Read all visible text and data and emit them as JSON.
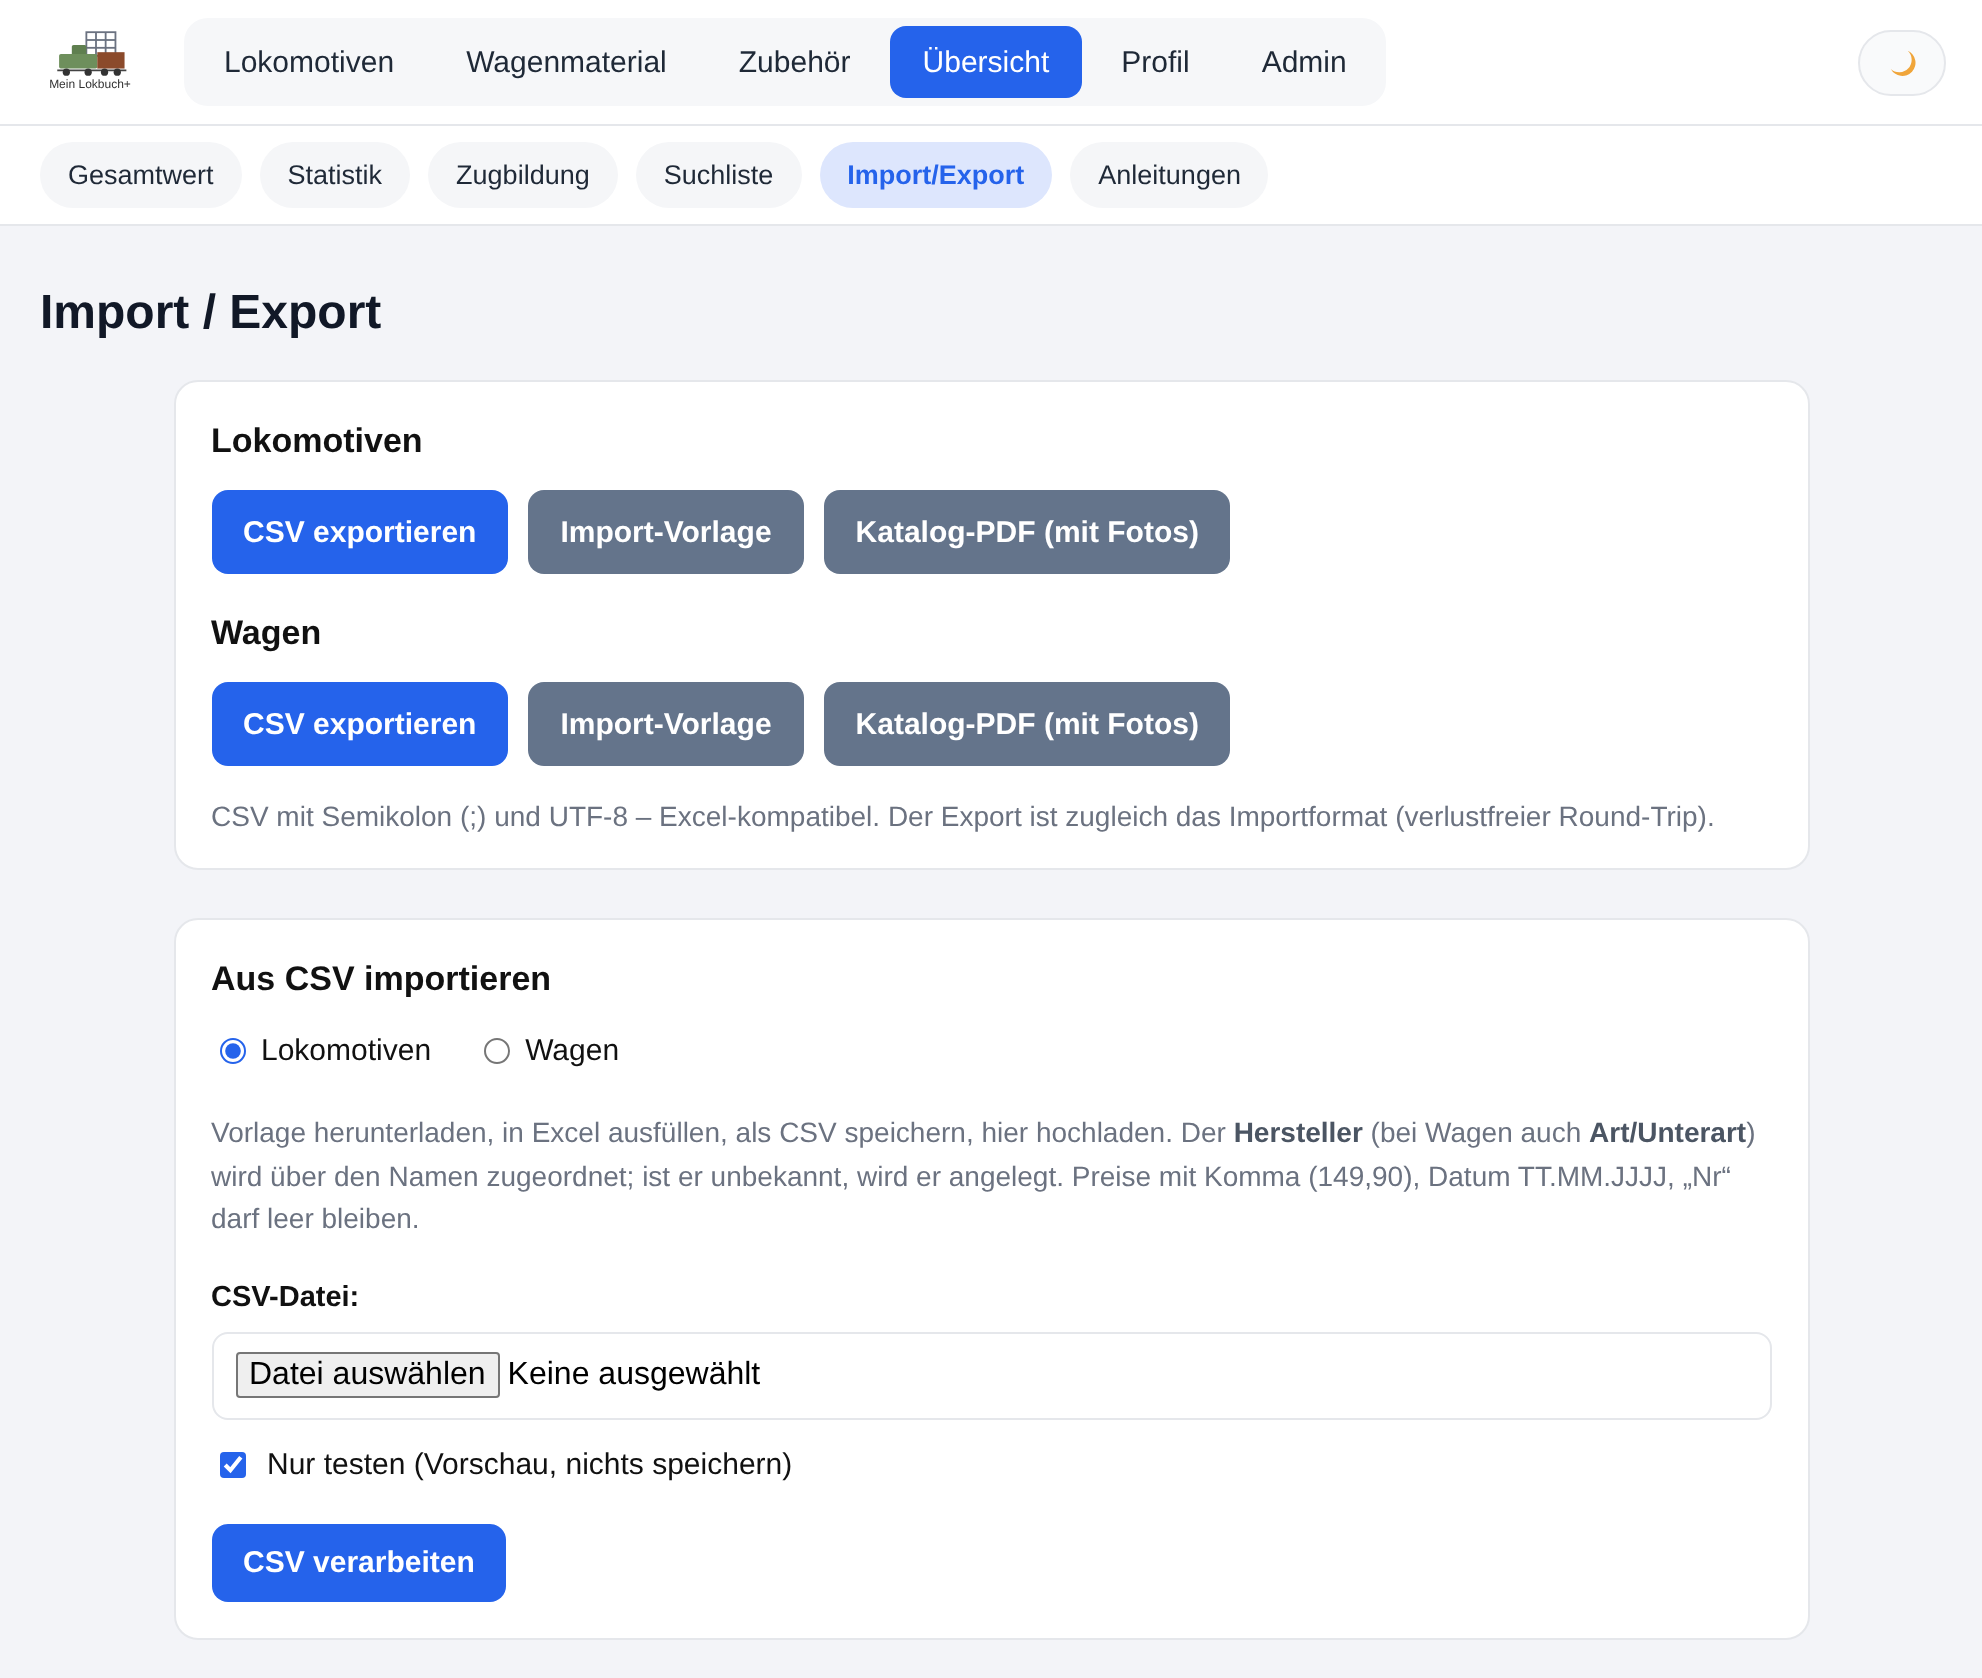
{
  "header": {
    "logo_text": "Mein Lokbuch+",
    "nav": [
      {
        "label": "Lokomotiven",
        "selected": false
      },
      {
        "label": "Wagenmaterial",
        "selected": false
      },
      {
        "label": "Zubehör",
        "selected": false
      },
      {
        "label": "Übersicht",
        "selected": true
      },
      {
        "label": "Profil",
        "selected": false
      },
      {
        "label": "Admin",
        "selected": false
      }
    ]
  },
  "subnav": [
    {
      "label": "Gesamtwert",
      "selected": false
    },
    {
      "label": "Statistik",
      "selected": false
    },
    {
      "label": "Zugbildung",
      "selected": false
    },
    {
      "label": "Suchliste",
      "selected": false
    },
    {
      "label": "Import/Export",
      "selected": true
    },
    {
      "label": "Anleitungen",
      "selected": false
    }
  ],
  "page_title": "Import / Export",
  "export_card": {
    "sections": [
      {
        "heading": "Lokomotiven",
        "buttons": [
          {
            "label": "CSV exportieren",
            "kind": "primary"
          },
          {
            "label": "Import-Vorlage",
            "kind": "secondary"
          },
          {
            "label": "Katalog-PDF (mit Fotos)",
            "kind": "secondary"
          }
        ]
      },
      {
        "heading": "Wagen",
        "buttons": [
          {
            "label": "CSV exportieren",
            "kind": "primary"
          },
          {
            "label": "Import-Vorlage",
            "kind": "secondary"
          },
          {
            "label": "Katalog-PDF (mit Fotos)",
            "kind": "secondary"
          }
        ]
      }
    ],
    "note": "CSV mit Semikolon (;) und UTF-8 – Excel-kompatibel. Der Export ist zugleich das Importformat (verlustfreier Round-Trip)."
  },
  "import_card": {
    "heading": "Aus CSV importieren",
    "radios": [
      {
        "label": "Lokomotiven",
        "selected": true
      },
      {
        "label": "Wagen",
        "selected": false
      }
    ],
    "help": "Vorlage herunterladen, in Excel ausfüllen, als CSV speichern, hier hochladen. Der **Hersteller** (bei Wagen auch **Art/Unterart**) wird über den Namen zugeordnet; ist er unbekannt, wird er angelegt. Preise mit Komma (149,90), Datum TT.MM.JJJJ, „Nr“ darf leer bleiben.",
    "file_label": "CSV-Datei:",
    "file_field": {
      "button": "Datei auswählen",
      "value": "Keine ausgewählt"
    },
    "test_only": {
      "label": "Nur testen (Vorschau, nichts speichern)",
      "checked": true
    },
    "submit": "CSV verarbeiten"
  }
}
